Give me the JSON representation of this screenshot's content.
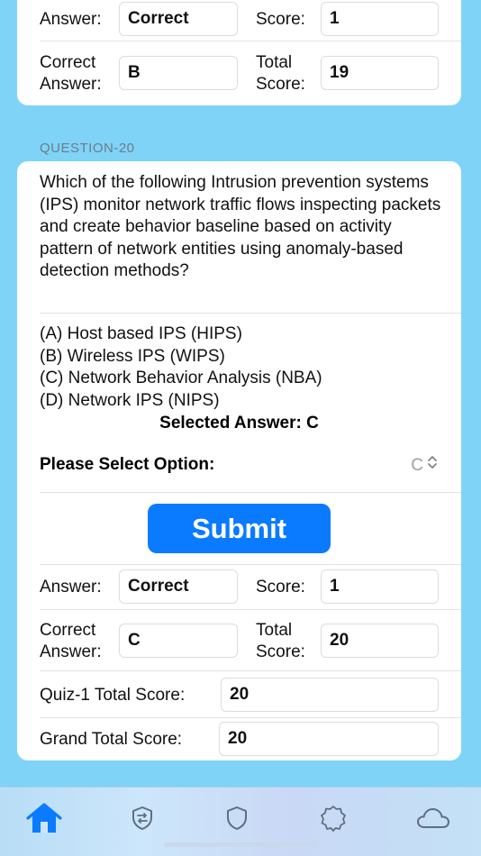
{
  "prev_result": {
    "answer_label": "Answer:",
    "answer_value": "Correct",
    "score_label": "Score:",
    "score_value": "1",
    "correct_label_line1": "Correct",
    "correct_label_line2": "Answer:",
    "correct_value": "B",
    "total_label_line1": "Total",
    "total_label_line2": "Score:",
    "total_value": "19"
  },
  "question": {
    "section_label": "QUESTION-20",
    "text": "Which of the following Intrusion prevention systems (IPS) monitor network traffic flows inspecting packets and create behavior baseline based on activity pattern of network entities using anomaly-based detection methods?",
    "options": [
      "(A) Host based IPS (HIPS)",
      "(B) Wireless IPS (WIPS)",
      "(C) Network Behavior Analysis (NBA)",
      "(D) Network IPS (NIPS)"
    ],
    "selected_answer": "Selected Answer: C",
    "select_label": "Please Select Option:",
    "select_value": "C",
    "submit_label": "Submit"
  },
  "result": {
    "answer_label": "Answer:",
    "answer_value": "Correct",
    "score_label": "Score:",
    "score_value": "1",
    "correct_label_line1": "Correct",
    "correct_label_line2": "Answer:",
    "correct_value": "C",
    "total_label_line1": "Total",
    "total_label_line2": "Score:",
    "total_value": "20",
    "quiz_total_label": "Quiz-1 Total Score:",
    "quiz_total_value": "20",
    "grand_total_label": "Grand Total Score:",
    "grand_total_value": "20"
  },
  "tabbar": {
    "active_color": "#0a7bff",
    "inactive_color": "#5f6f80",
    "tabs": [
      {
        "icon": "home-icon",
        "active": true
      },
      {
        "icon": "shield-swap-icon",
        "active": false
      },
      {
        "icon": "shield-icon",
        "active": false
      },
      {
        "icon": "badge-icon",
        "active": false
      },
      {
        "icon": "cloud-icon",
        "active": false
      }
    ]
  }
}
